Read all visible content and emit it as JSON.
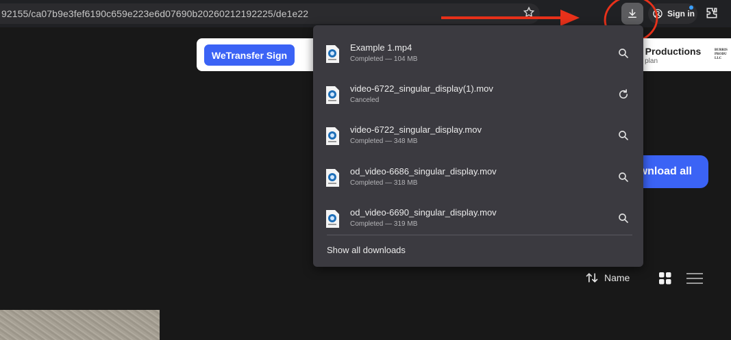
{
  "browser": {
    "url": "92155/ca07b9e3fef6190c659e223e6d07690b20260212192225/de1e22",
    "sign_in_label": "Sign in"
  },
  "page": {
    "wetransfer_button": "WeTransfer Sign",
    "production_name": "s Productions",
    "production_sub": "te plan",
    "production_logo": "BURRIS PRODU LLC",
    "download_all_label": "wnload all",
    "sort_label": "Name"
  },
  "downloads": {
    "items": [
      {
        "name": "Example 1.mp4",
        "status": "Completed — 104 MB",
        "action": "search-icon"
      },
      {
        "name": "video-6722_singular_display(1).mov",
        "status": "Canceled",
        "action": "retry-icon"
      },
      {
        "name": "video-6722_singular_display.mov",
        "status": "Completed — 348 MB",
        "action": "search-icon"
      },
      {
        "name": "od_video-6686_singular_display.mov",
        "status": "Completed — 318 MB",
        "action": "search-icon"
      },
      {
        "name": "od_video-6690_singular_display.mov",
        "status": "Completed — 319 MB",
        "action": "search-icon"
      }
    ],
    "show_all_label": "Show all downloads"
  },
  "colors": {
    "accent": "#3b63f5",
    "annotation": "#e8311a",
    "panel": "#3b3a40"
  }
}
